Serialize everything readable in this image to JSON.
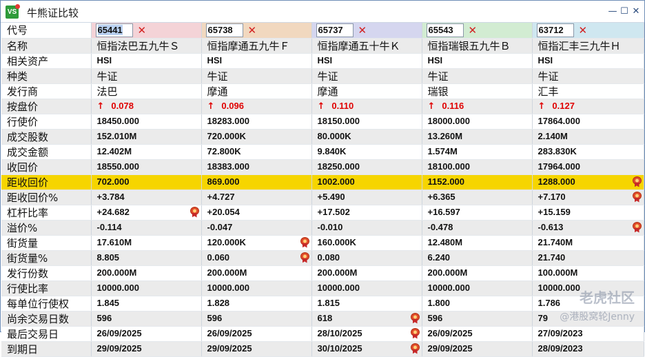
{
  "window": {
    "icon_text": "VS",
    "title": "牛熊证比较",
    "controls": [
      "×",
      "□",
      "×"
    ]
  },
  "code_row_label": "代号",
  "columns": [
    {
      "code": "65441",
      "name": "恒指法巴五九牛Ｓ",
      "asset": "HSI",
      "type": "牛证",
      "issuer": "法巴",
      "price": "0.078",
      "strike": "18450.000",
      "volume": "152.010M",
      "turnover": "12.402M",
      "call_price": "18550.000",
      "dist_call": "702.000",
      "dist_call_pct": "+3.784",
      "leverage": "+24.682",
      "premium": "-0.114",
      "outstanding": "17.610M",
      "outstanding_pct": "8.805",
      "issue_size": "200.000M",
      "ratio": "10000.000",
      "per_unit": "1.845",
      "days_left": "596",
      "last_trade": "26/09/2025",
      "expiry": "29/09/2025"
    },
    {
      "code": "65738",
      "name": "恒指摩通五九牛Ｆ",
      "asset": "HSI",
      "type": "牛证",
      "issuer": "摩通",
      "price": "0.096",
      "strike": "18283.000",
      "volume": "720.000K",
      "turnover": "72.800K",
      "call_price": "18383.000",
      "dist_call": "869.000",
      "dist_call_pct": "+4.727",
      "leverage": "+20.054",
      "premium": "-0.047",
      "outstanding": "120.000K",
      "outstanding_pct": "0.060",
      "issue_size": "200.000M",
      "ratio": "10000.000",
      "per_unit": "1.828",
      "days_left": "596",
      "last_trade": "26/09/2025",
      "expiry": "29/09/2025"
    },
    {
      "code": "65737",
      "name": "恒指摩通五十牛Ｋ",
      "asset": "HSI",
      "type": "牛证",
      "issuer": "摩通",
      "price": "0.110",
      "strike": "18150.000",
      "volume": "80.000K",
      "turnover": "9.840K",
      "call_price": "18250.000",
      "dist_call": "1002.000",
      "dist_call_pct": "+5.490",
      "leverage": "+17.502",
      "premium": "-0.010",
      "outstanding": "160.000K",
      "outstanding_pct": "0.080",
      "issue_size": "200.000M",
      "ratio": "10000.000",
      "per_unit": "1.815",
      "days_left": "618",
      "last_trade": "28/10/2025",
      "expiry": "30/10/2025"
    },
    {
      "code": "65543",
      "name": "恒指瑞银五九牛Ｂ",
      "asset": "HSI",
      "type": "牛证",
      "issuer": "瑞银",
      "price": "0.116",
      "strike": "18000.000",
      "volume": "13.260M",
      "turnover": "1.574M",
      "call_price": "18100.000",
      "dist_call": "1152.000",
      "dist_call_pct": "+6.365",
      "leverage": "+16.597",
      "premium": "-0.478",
      "outstanding": "12.480M",
      "outstanding_pct": "6.240",
      "issue_size": "200.000M",
      "ratio": "10000.000",
      "per_unit": "1.800",
      "days_left": "596",
      "last_trade": "26/09/2025",
      "expiry": "29/09/2025"
    },
    {
      "code": "63712",
      "name": "恒指汇丰三九牛Ｈ",
      "asset": "HSI",
      "type": "牛证",
      "issuer": "汇丰",
      "price": "0.127",
      "strike": "17864.000",
      "volume": "2.140M",
      "turnover": "283.830K",
      "call_price": "17964.000",
      "dist_call": "1288.000",
      "dist_call_pct": "+7.170",
      "leverage": "+15.159",
      "premium": "-0.613",
      "outstanding": "21.740M",
      "outstanding_pct": "21.740",
      "issue_size": "100.000M",
      "ratio": "10000.000",
      "per_unit": "1.786",
      "days_left": "79",
      "last_trade": "27/09/2023",
      "expiry": "28/09/2023"
    }
  ],
  "rows": [
    {
      "key": "name",
      "label": "名称",
      "style": "cn"
    },
    {
      "key": "asset",
      "label": "相关资产",
      "style": "num"
    },
    {
      "key": "type",
      "label": "种类",
      "style": "cn"
    },
    {
      "key": "issuer",
      "label": "发行商",
      "style": "cn"
    },
    {
      "key": "price",
      "label": "按盘价",
      "style": "price"
    },
    {
      "key": "strike",
      "label": "行使价",
      "style": "num"
    },
    {
      "key": "volume",
      "label": "成交股数",
      "style": "num"
    },
    {
      "key": "turnover",
      "label": "成交金额",
      "style": "num"
    },
    {
      "key": "call_price",
      "label": "收回价",
      "style": "num"
    },
    {
      "key": "dist_call",
      "label": "距收回价",
      "style": "num",
      "highlight": true
    },
    {
      "key": "dist_call_pct",
      "label": "距收回价%",
      "style": "num"
    },
    {
      "key": "leverage",
      "label": "杠杆比率",
      "style": "num"
    },
    {
      "key": "premium",
      "label": "溢价%",
      "style": "num"
    },
    {
      "key": "outstanding",
      "label": "街货量",
      "style": "num"
    },
    {
      "key": "outstanding_pct",
      "label": "街货量%",
      "style": "num"
    },
    {
      "key": "issue_size",
      "label": "发行份数",
      "style": "num"
    },
    {
      "key": "ratio",
      "label": "行使比率",
      "style": "num"
    },
    {
      "key": "per_unit",
      "label": "每单位行使权",
      "style": "num"
    },
    {
      "key": "days_left",
      "label": "尚余交易日数",
      "style": "num"
    },
    {
      "key": "last_trade",
      "label": "最后交易日",
      "style": "num"
    },
    {
      "key": "expiry",
      "label": "到期日",
      "style": "num"
    }
  ],
  "medals": {
    "dist_call": [
      4
    ],
    "dist_call_pct": [
      4
    ],
    "leverage": [
      0
    ],
    "premium": [
      4
    ],
    "outstanding": [
      1
    ],
    "outstanding_pct": [
      1
    ],
    "days_left": [
      2
    ],
    "last_trade": [
      2
    ],
    "expiry": [
      2
    ]
  },
  "icons": {
    "up_arrow": "↑",
    "delete": "✕",
    "medal": "award-medal-icon"
  },
  "colors": {
    "highlight_row": "#f6d500",
    "price_red": "#e00000",
    "col_headers": [
      "#f4d3d7",
      "#f1d8bf",
      "#d5d6ef",
      "#d2ecd2",
      "#cfe7f0"
    ]
  },
  "watermark": {
    "line1": "老虎社区",
    "line2": "@港股窝轮Jenny"
  }
}
